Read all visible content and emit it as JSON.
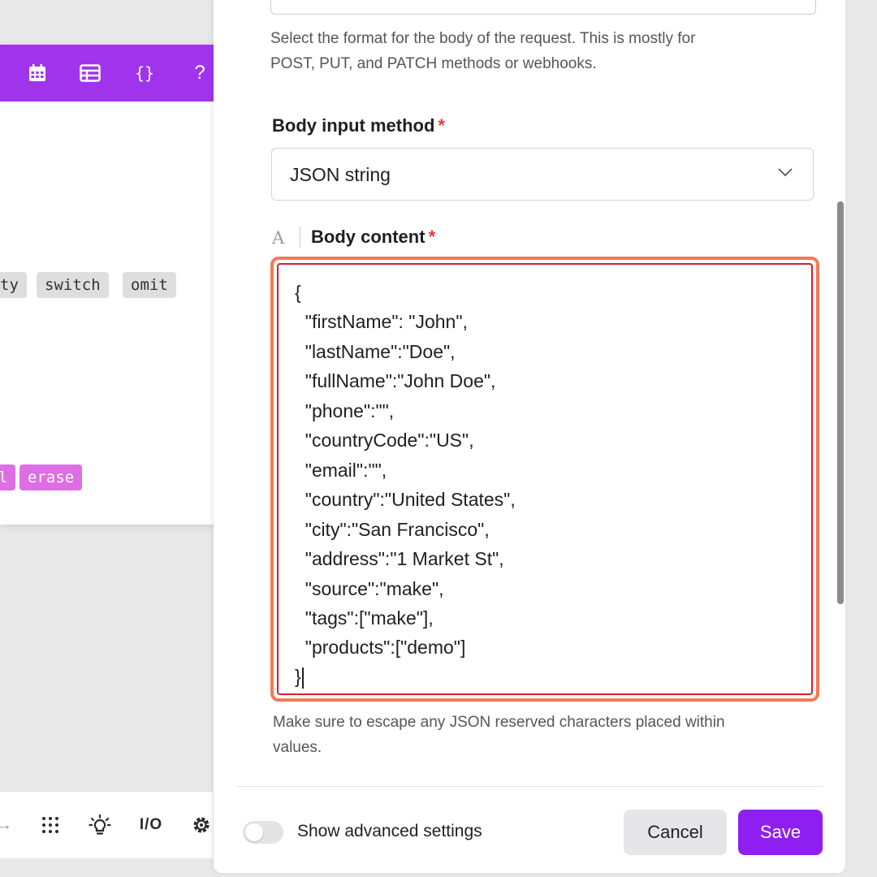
{
  "popover": {
    "header_icons": [
      "calendar-icon",
      "table-icon",
      "braces-icon",
      "help-icon",
      "close-icon"
    ],
    "braces_text": "{}",
    "help_text": "?",
    "close_text": "✕",
    "function_chips_gray": [
      "ty",
      "switch",
      "omit"
    ],
    "function_chips_pink": [
      "l",
      "erase"
    ]
  },
  "toolbar": {
    "icons": [
      "arrow-icon",
      "grid-dots-icon",
      "lightbulb-icon",
      "io-icon",
      "gear-icon"
    ],
    "io_text": "I/O",
    "arrow_text": "→"
  },
  "panel": {
    "body_type_help": {
      "line1": "Select the format for the body of the request. This is mostly for",
      "line2": "POST, PUT, and PATCH methods or webhooks."
    },
    "body_input_method": {
      "label": "Body input method",
      "required_mark": "*",
      "value": "JSON string"
    },
    "body_content": {
      "type_indicator": "A",
      "label": "Body content",
      "required_mark": "*",
      "lines": [
        "{",
        "  \"firstName\": \"John\",",
        "  \"lastName\":\"Doe\",",
        "  \"fullName\":\"John Doe\",",
        "  \"phone\":\"\",",
        "  \"countryCode\":\"US\",",
        "  \"email\":\"\",",
        "  \"country\":\"United States\",",
        "  \"city\":\"San Francisco\",",
        "  \"address\":\"1 Market St\",",
        "  \"source\":\"make\",",
        "  \"tags\":[\"make\"],",
        "  \"products\":[\"demo\"]",
        "}"
      ]
    },
    "escape_help": {
      "line1": "Make sure to escape any JSON reserved characters placed within",
      "line2": "values."
    },
    "footer": {
      "advanced_toggle_label": "Show advanced settings",
      "advanced_toggle_on": false,
      "cancel_label": "Cancel",
      "save_label": "Save"
    }
  },
  "colors": {
    "popover_header": "#a034ec",
    "save_button": "#8f1ff0",
    "editor_focus_ring": "#f47a53",
    "editor_border": "#d41e2b",
    "required": "#e5383b",
    "chip_pink": "#dd6ee3"
  }
}
